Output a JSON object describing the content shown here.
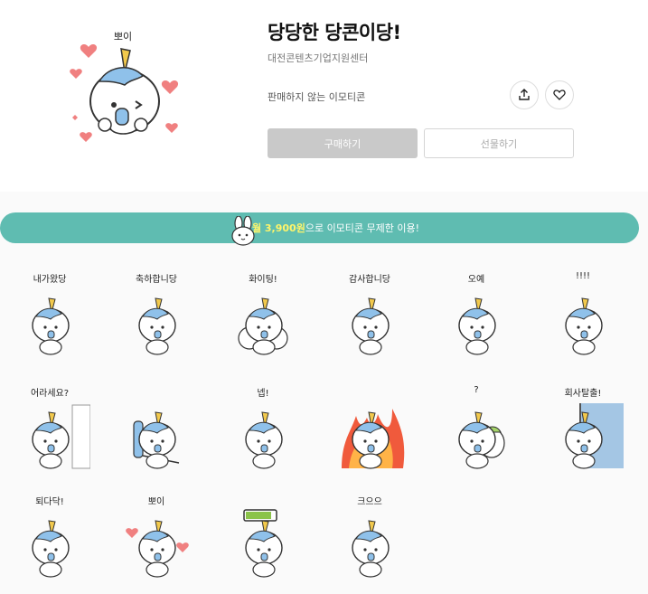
{
  "product": {
    "title": "당당한 당콘이당!",
    "author": "대전콘텐츠기업지원센터",
    "status": "판매하지 않는 이모티콘",
    "buy_label": "구매하기",
    "gift_label": "선물하기",
    "hero_caption": "뽀이"
  },
  "promo": {
    "highlight": "월 3,900원",
    "text": "으로 이모티콘 무제한 이용!"
  },
  "stickers": [
    {
      "caption": "내가왔당",
      "variant": "wave"
    },
    {
      "caption": "축하합니당",
      "variant": "party"
    },
    {
      "caption": "화이팅!",
      "variant": "cheer"
    },
    {
      "caption": "감사합니당",
      "variant": "bow"
    },
    {
      "caption": "오예",
      "variant": "dance"
    },
    {
      "caption": "!!!!",
      "variant": "shock"
    },
    {
      "caption": "어라세요?",
      "variant": "peek"
    },
    {
      "caption": "",
      "variant": "chair"
    },
    {
      "caption": "넵!",
      "variant": "yes"
    },
    {
      "caption": "",
      "variant": "fire"
    },
    {
      "caption": "?",
      "variant": "friends"
    },
    {
      "caption": "회사탈출!",
      "variant": "escape"
    },
    {
      "caption": "퇴다닥!",
      "variant": "run"
    },
    {
      "caption": "뽀이",
      "variant": "love"
    },
    {
      "caption": "",
      "variant": "battery"
    },
    {
      "caption": "크으으",
      "variant": "joy"
    }
  ],
  "colors": {
    "promo_bg": "#5fbcb1",
    "promo_highlight": "#fff56a",
    "buy_disabled": "#c9c9c9",
    "unicorn_mane": "#8fc1ea",
    "unicorn_horn": "#f2c94c",
    "heart": "#f08080"
  }
}
